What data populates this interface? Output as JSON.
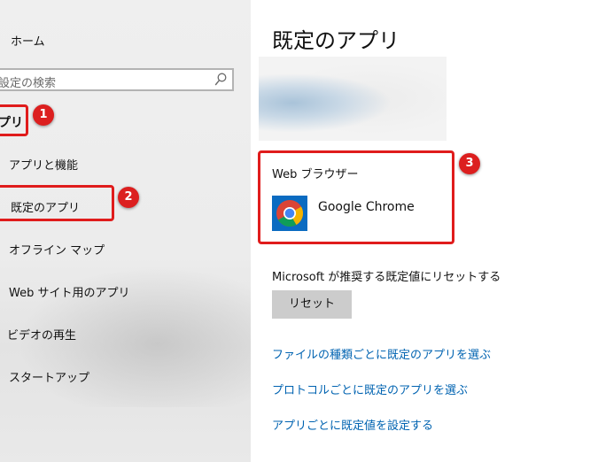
{
  "sidebar": {
    "home_label": "ホーム",
    "search_placeholder": "設定の検索",
    "section_label": "プリ",
    "items": [
      {
        "label": "アプリと機能"
      },
      {
        "label": "既定のアプリ"
      },
      {
        "label": "オフライン マップ"
      },
      {
        "label": "Web サイト用のアプリ"
      },
      {
        "label": "ビデオの再生"
      },
      {
        "label": "スタートアップ"
      }
    ]
  },
  "annotations": {
    "marker_1": "1",
    "marker_2": "2",
    "marker_3": "3",
    "color": "#e01c1c"
  },
  "main": {
    "title": "既定のアプリ",
    "web_browser": {
      "heading": "Web ブラウザー",
      "app_name": "Google Chrome",
      "icon": "chrome-icon"
    },
    "reset_text": "Microsoft が推奨する既定値にリセットする",
    "reset_button": "リセット",
    "links": [
      "ファイルの種類ごとに既定のアプリを選ぶ",
      "プロトコルごとに既定のアプリを選ぶ",
      "アプリごとに既定値を設定する"
    ],
    "link_color": "#0063b1"
  }
}
